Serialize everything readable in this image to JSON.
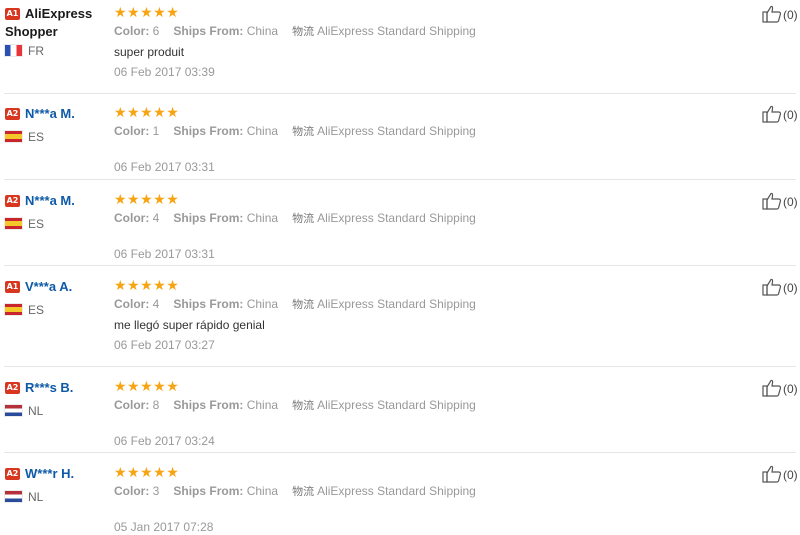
{
  "reviews": [
    {
      "level": "A1",
      "name": "AliExpress Shopper",
      "country": "FR",
      "flag": "fr",
      "color": "6",
      "ships_from": "China",
      "logistics": "AliExpress Standard Shipping",
      "feedback": "super produit",
      "date": "06 Feb 2017 03:39",
      "helpful": "(0)"
    },
    {
      "level": "A2",
      "name": "N***a M.",
      "country": "ES",
      "flag": "es",
      "color": "1",
      "ships_from": "China",
      "logistics": "AliExpress Standard Shipping",
      "feedback": "",
      "date": "06 Feb 2017 03:31",
      "helpful": "(0)"
    },
    {
      "level": "A2",
      "name": "N***a M.",
      "country": "ES",
      "flag": "es",
      "color": "4",
      "ships_from": "China",
      "logistics": "AliExpress Standard Shipping",
      "feedback": "",
      "date": "06 Feb 2017 03:31",
      "helpful": "(0)"
    },
    {
      "level": "A1",
      "name": "V***a A.",
      "country": "ES",
      "flag": "es",
      "color": "4",
      "ships_from": "China",
      "logistics": "AliExpress Standard Shipping",
      "feedback": "me llegó super rápido genial",
      "date": "06 Feb 2017 03:27",
      "helpful": "(0)"
    },
    {
      "level": "A2",
      "name": "R***s B.",
      "country": "NL",
      "flag": "nl",
      "color": "8",
      "ships_from": "China",
      "logistics": "AliExpress Standard Shipping",
      "feedback": "",
      "date": "06 Feb 2017 03:24",
      "helpful": "(0)"
    },
    {
      "level": "A2",
      "name": "W***r H.",
      "country": "NL",
      "flag": "nl",
      "color": "3",
      "ships_from": "China",
      "logistics": "AliExpress Standard Shipping",
      "feedback": "",
      "date": "05 Jan 2017 07:28",
      "helpful": "(0)"
    }
  ],
  "labels": {
    "color": "Color:",
    "ships_from": "Ships From:",
    "logistics": "物流"
  },
  "rating": 5,
  "colors": {
    "star": "#f7a412",
    "level_badge": "#d9361f",
    "name_link": "#0e5aa7"
  }
}
